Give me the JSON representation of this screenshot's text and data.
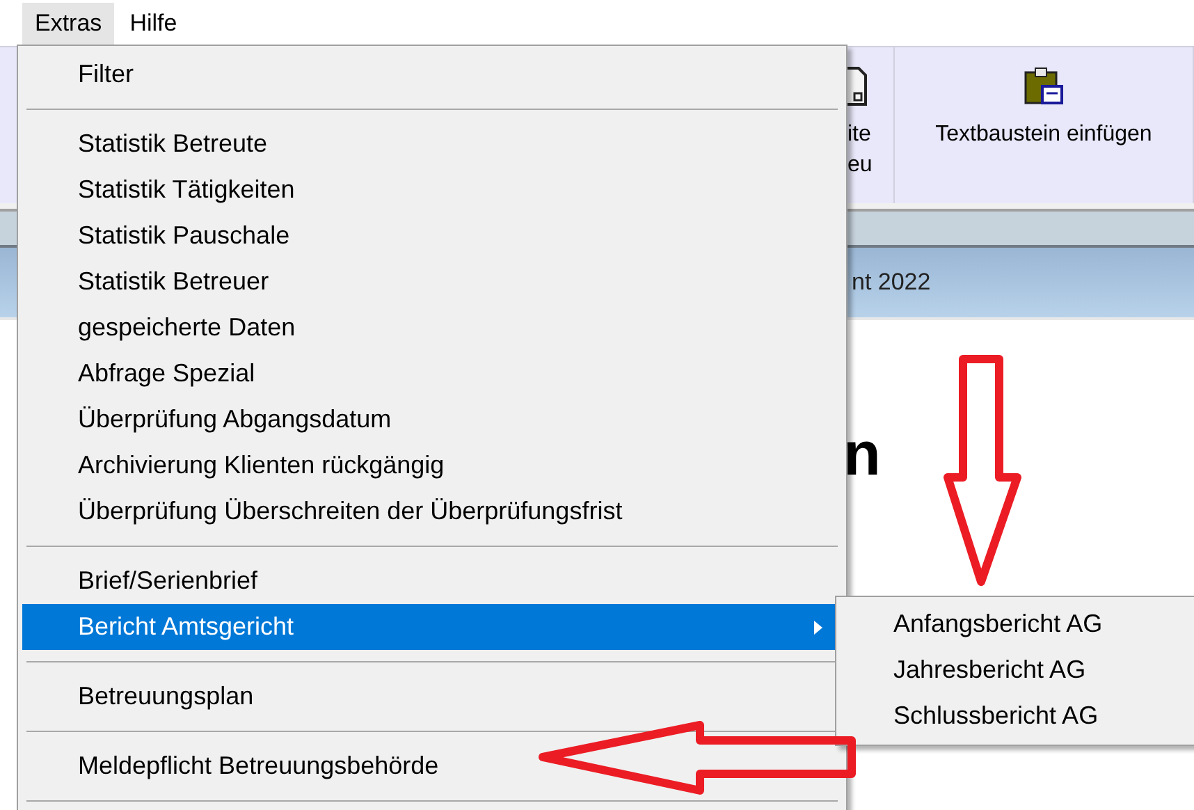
{
  "menu_bar": [
    {
      "label": "Extras",
      "selected": true
    },
    {
      "label": "Hilfe",
      "selected": false
    }
  ],
  "toolbar": {
    "buttons": [
      {
        "kind": "document",
        "lines": [
          "ite",
          "eu"
        ]
      },
      {
        "kind": "clipboard",
        "lines": [
          "Textbaustein einfügen"
        ]
      }
    ]
  },
  "header": {
    "title": "nt 2022"
  },
  "content": {
    "heading": "n"
  },
  "menu": {
    "groups": [
      [
        {
          "label": "Filter",
          "kind": "command",
          "selected": false
        }
      ],
      [
        {
          "label": "Statistik Betreute",
          "kind": "command",
          "selected": false
        },
        {
          "label": "Statistik Tätigkeiten",
          "kind": "command",
          "selected": false
        },
        {
          "label": "Statistik Pauschale",
          "kind": "command",
          "selected": false
        },
        {
          "label": "Statistik Betreuer",
          "kind": "command",
          "selected": false
        },
        {
          "label": "gespeicherte Daten",
          "kind": "command",
          "selected": false
        },
        {
          "label": "Abfrage Spezial",
          "kind": "command",
          "selected": false
        },
        {
          "label": "Überprüfung Abgangsdatum",
          "kind": "command",
          "selected": false
        },
        {
          "label": "Archivierung Klienten rückgängig",
          "kind": "command",
          "selected": false
        },
        {
          "label": "Überprüfung Überschreiten der Überprüfungsfrist",
          "kind": "command",
          "selected": false
        }
      ],
      [
        {
          "label": "Brief/Serienbrief",
          "kind": "command",
          "selected": false
        },
        {
          "label": "Bericht Amtsgericht",
          "kind": "submenu",
          "selected": true
        }
      ],
      [
        {
          "label": "Betreuungsplan",
          "kind": "command",
          "selected": false
        }
      ],
      [
        {
          "label": "Meldepflicht Betreuungsbehörde",
          "kind": "command",
          "selected": false
        }
      ]
    ]
  },
  "submenu": {
    "items": [
      {
        "label": "Anfangsbericht AG"
      },
      {
        "label": "Jahresbericht AG"
      },
      {
        "label": "Schlussbericht AG"
      }
    ]
  }
}
